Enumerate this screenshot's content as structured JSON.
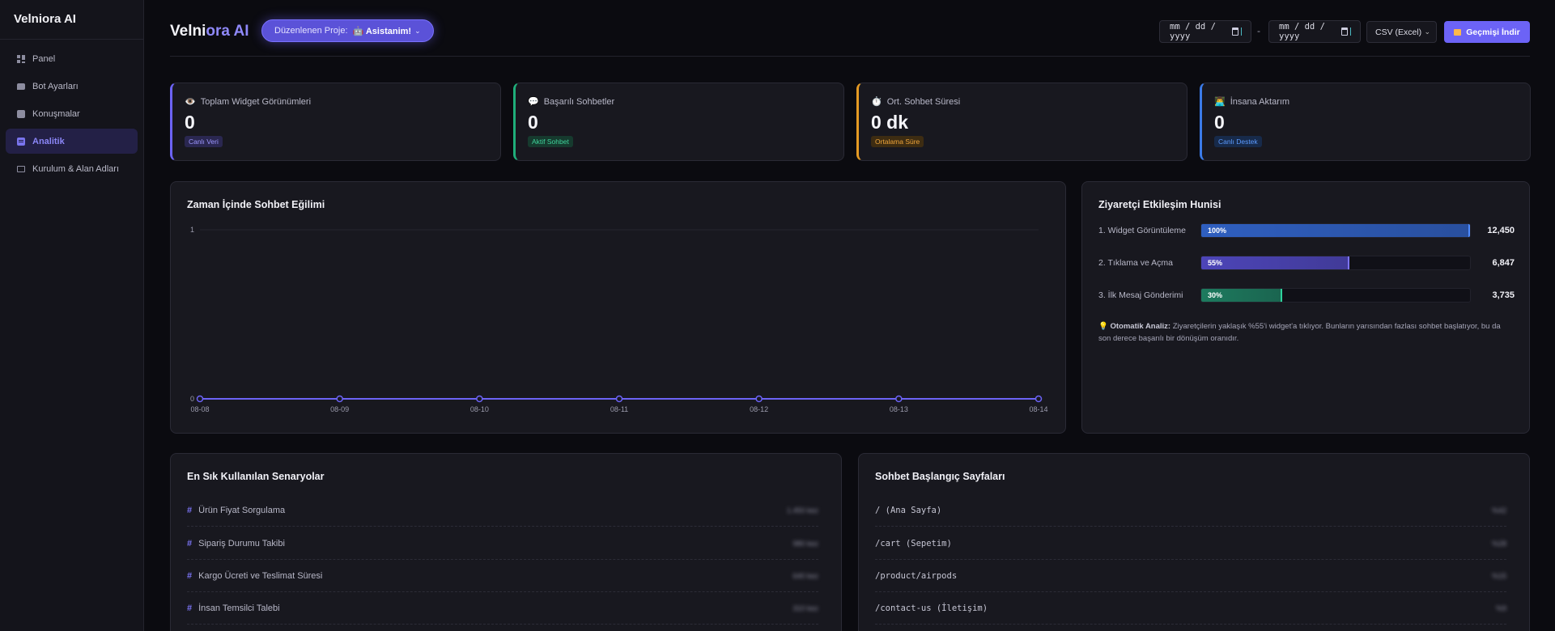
{
  "sidebar": {
    "brand": "Velniora AI",
    "items": [
      {
        "label": "Panel",
        "icon": "dashboard-icon"
      },
      {
        "label": "Bot Ayarları",
        "icon": "chat-icon"
      },
      {
        "label": "Konuşmalar",
        "icon": "conversation-icon"
      },
      {
        "label": "Analitik",
        "icon": "analytics-icon",
        "active": true
      },
      {
        "label": "Kurulum & Alan Adları",
        "icon": "monitor-icon"
      }
    ]
  },
  "header": {
    "title_main": "Velni",
    "title_accent": "ora AI",
    "project_label": "Düzenlenen Proje:",
    "project_value": "🤖 Asistanim!",
    "date_from_placeholder": "mm / dd / yyyy",
    "date_to_placeholder": "mm / dd / yyyy",
    "date_separator": "-",
    "format_select": "CSV (Excel)",
    "download_label": "Geçmişi İndir"
  },
  "stats": [
    {
      "emoji": "👁️",
      "label": "Toplam Widget Görünümleri",
      "value": "0",
      "badge": "Canlı Veri",
      "color": "#6c63f6"
    },
    {
      "emoji": "💬",
      "label": "Başarılı Sohbetler",
      "value": "0",
      "badge": "Aktif Sohbet",
      "color": "#1fae7a"
    },
    {
      "emoji": "⏱️",
      "label": "Ort. Sohbet Süresi",
      "value": "0 dk",
      "badge": "Ortalama Süre",
      "color": "#e59a23"
    },
    {
      "emoji": "👨‍💻",
      "label": "İnsana Aktarım",
      "value": "0",
      "badge": "Canlı Destek",
      "color": "#3b7be8"
    }
  ],
  "chart": {
    "title": "Zaman İçinde Sohbet Eğilimi"
  },
  "chart_data": {
    "type": "line",
    "title": "Zaman İçinde Sohbet Eğilimi",
    "categories": [
      "08-08",
      "08-09",
      "08-10",
      "08-11",
      "08-12",
      "08-13",
      "08-14"
    ],
    "values": [
      0,
      0,
      0,
      0,
      0,
      0,
      0
    ],
    "ylim": [
      0,
      1
    ],
    "yticks": [
      "0",
      "1"
    ],
    "color": "#6c63f6",
    "grid": true
  },
  "funnel": {
    "title": "Ziyaretçi Etkileşim Hunisi",
    "rows": [
      {
        "label": "1. Widget Görüntüleme",
        "percent_label": "100%",
        "fraction": 1.0,
        "value": "12,450",
        "color": "#2f5fc0",
        "edge": "#4e8cff"
      },
      {
        "label": "2. Tıklama ve Açma",
        "percent_label": "55%",
        "fraction": 0.55,
        "value": "6,847",
        "color": "#4d45b8",
        "edge": "#7c74ff"
      },
      {
        "label": "3. İlk Mesaj Gönderimi",
        "percent_label": "30%",
        "fraction": 0.3,
        "value": "3,735",
        "color": "#1d7a5e",
        "edge": "#2fd19c"
      }
    ],
    "note_emoji": "💡",
    "note_bold": "Otomatik Analiz:",
    "note_text": "Ziyaretçilerin yaklaşık %55'i widget'a tıklıyor. Bunların yarısından fazlası sohbet başlatıyor, bu da son derece başarılı bir dönüşüm oranıdır."
  },
  "scenarios": {
    "title": "En Sık Kullanılan Senaryolar",
    "items": [
      {
        "label": "Ürün Fiyat Sorgulama",
        "count": "1.450 kez"
      },
      {
        "label": "Sipariş Durumu Takibi",
        "count": "980 kez"
      },
      {
        "label": "Kargo Ücreti ve Teslimat Süresi",
        "count": "640 kez"
      },
      {
        "label": "İnsan Temsilci Talebi",
        "count": "310 kez"
      }
    ]
  },
  "pages": {
    "title": "Sohbet Başlangıç Sayfaları",
    "items": [
      {
        "label": "/ (Ana Sayfa)",
        "count": "%42"
      },
      {
        "label": "/cart (Sepetim)",
        "count": "%28"
      },
      {
        "label": "/product/airpods",
        "count": "%15"
      },
      {
        "label": "/contact-us (İletişim)",
        "count": "%9"
      }
    ]
  }
}
